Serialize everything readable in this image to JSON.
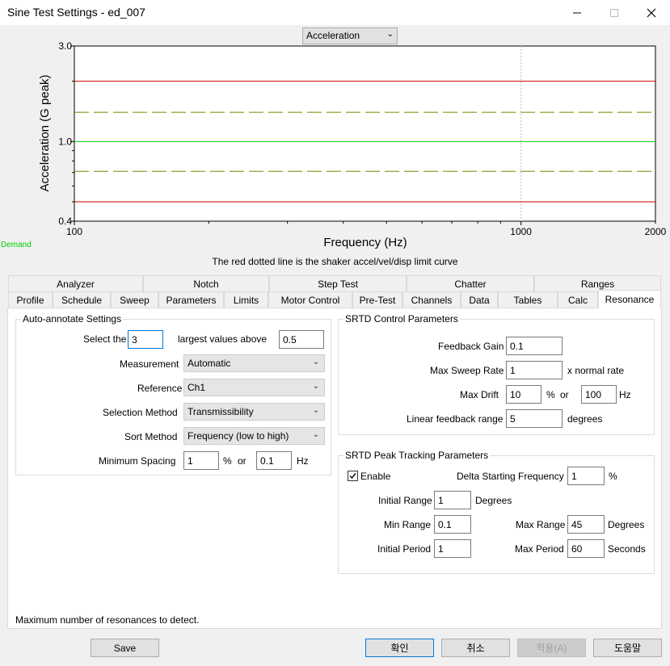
{
  "window": {
    "title": "Sine Test Settings - ed_007",
    "minimize_icon": "minimize-icon",
    "maximize_icon": "maximize-icon",
    "close_icon": "close-icon"
  },
  "plot_selector": {
    "value": "Acceleration"
  },
  "chart_data": {
    "type": "line",
    "xlabel": "Frequency (Hz)",
    "ylabel": "Acceleration (G peak)",
    "x_scale": "log",
    "y_scale": "log",
    "xlim": [
      100,
      2000
    ],
    "ylim": [
      0.4,
      3.0
    ],
    "x_ticks": [
      "100",
      "1000",
      "2000"
    ],
    "y_ticks": [
      "0.4",
      "1.0",
      "3.0"
    ],
    "x_gridlines": [
      1000
    ],
    "series": [
      {
        "color": "#cc0000",
        "style": "solid",
        "x": [
          100,
          2000
        ],
        "y": [
          2.0,
          2.0
        ]
      },
      {
        "color": "#808000",
        "style": "dashed",
        "x": [
          100,
          2000
        ],
        "y": [
          1.4,
          1.4
        ]
      },
      {
        "color": "#00cc00",
        "style": "solid",
        "x": [
          100,
          2000
        ],
        "y": [
          1.0,
          1.0
        ]
      },
      {
        "color": "#808000",
        "style": "dashed",
        "x": [
          100,
          2000
        ],
        "y": [
          0.71,
          0.71
        ]
      },
      {
        "color": "#cc0000",
        "style": "solid",
        "x": [
          100,
          2000
        ],
        "y": [
          0.5,
          0.5
        ]
      }
    ],
    "annotations": [
      "Demand"
    ]
  },
  "demand_label": "Demand",
  "chart_caption": "The red dotted line is the shaker accel/vel/disp limit curve",
  "tabs_row1": [
    "Analyzer",
    "Notch",
    "Step Test",
    "Chatter",
    "Ranges"
  ],
  "tabs_row2": [
    "Profile",
    "Schedule",
    "Sweep",
    "Parameters",
    "Limits",
    "Motor Control",
    "Pre-Test",
    "Channels",
    "Data",
    "Tables",
    "Calc",
    "Resonance"
  ],
  "active_tab": "Resonance",
  "auto": {
    "title": "Auto-annotate Settings",
    "select_the": "Select the",
    "count": "3",
    "largest_above": "largest values above",
    "threshold": "0.5",
    "measurement_label": "Measurement",
    "measurement": "Automatic",
    "reference_label": "Reference",
    "reference": "Ch1",
    "selection_label": "Selection Method",
    "selection": "Transmissibility",
    "sort_label": "Sort Method",
    "sort": "Frequency (low to high)",
    "spacing_label": "Minimum Spacing",
    "spacing_pct": "1",
    "pct": "%",
    "or": "or",
    "spacing_hz": "0.1",
    "hz": "Hz"
  },
  "srtd_control": {
    "title": "SRTD Control Parameters",
    "gain_label": "Feedback Gain",
    "gain": "0.1",
    "sweep_label": "Max Sweep Rate",
    "sweep": "1",
    "sweep_unit": "x normal rate",
    "drift_label": "Max Drift",
    "drift_pct": "10",
    "pct": "%",
    "or": "or",
    "drift_hz": "100",
    "hz": "Hz",
    "linear_label": "Linear feedback range",
    "linear": "5",
    "degrees": "degrees"
  },
  "srtd_peak": {
    "title": "SRTD Peak Tracking Parameters",
    "enable_label": "Enable",
    "enable_checked": true,
    "delta_label": "Delta Starting Frequency",
    "delta": "1",
    "pct": "%",
    "init_range_label": "Initial Range",
    "init_range": "1",
    "degrees": "Degrees",
    "min_range_label": "Min Range",
    "min_range": "0.1",
    "max_range_label": "Max Range",
    "max_range": "45",
    "init_period_label": "Initial Period",
    "init_period": "1",
    "max_period_label": "Max Period",
    "max_period": "60",
    "seconds": "Seconds"
  },
  "hint": "Maximum number of resonances to detect.",
  "buttons": {
    "save": "Save",
    "ok": "확인",
    "cancel": "취소",
    "apply": "적용(A)",
    "help": "도움말"
  }
}
